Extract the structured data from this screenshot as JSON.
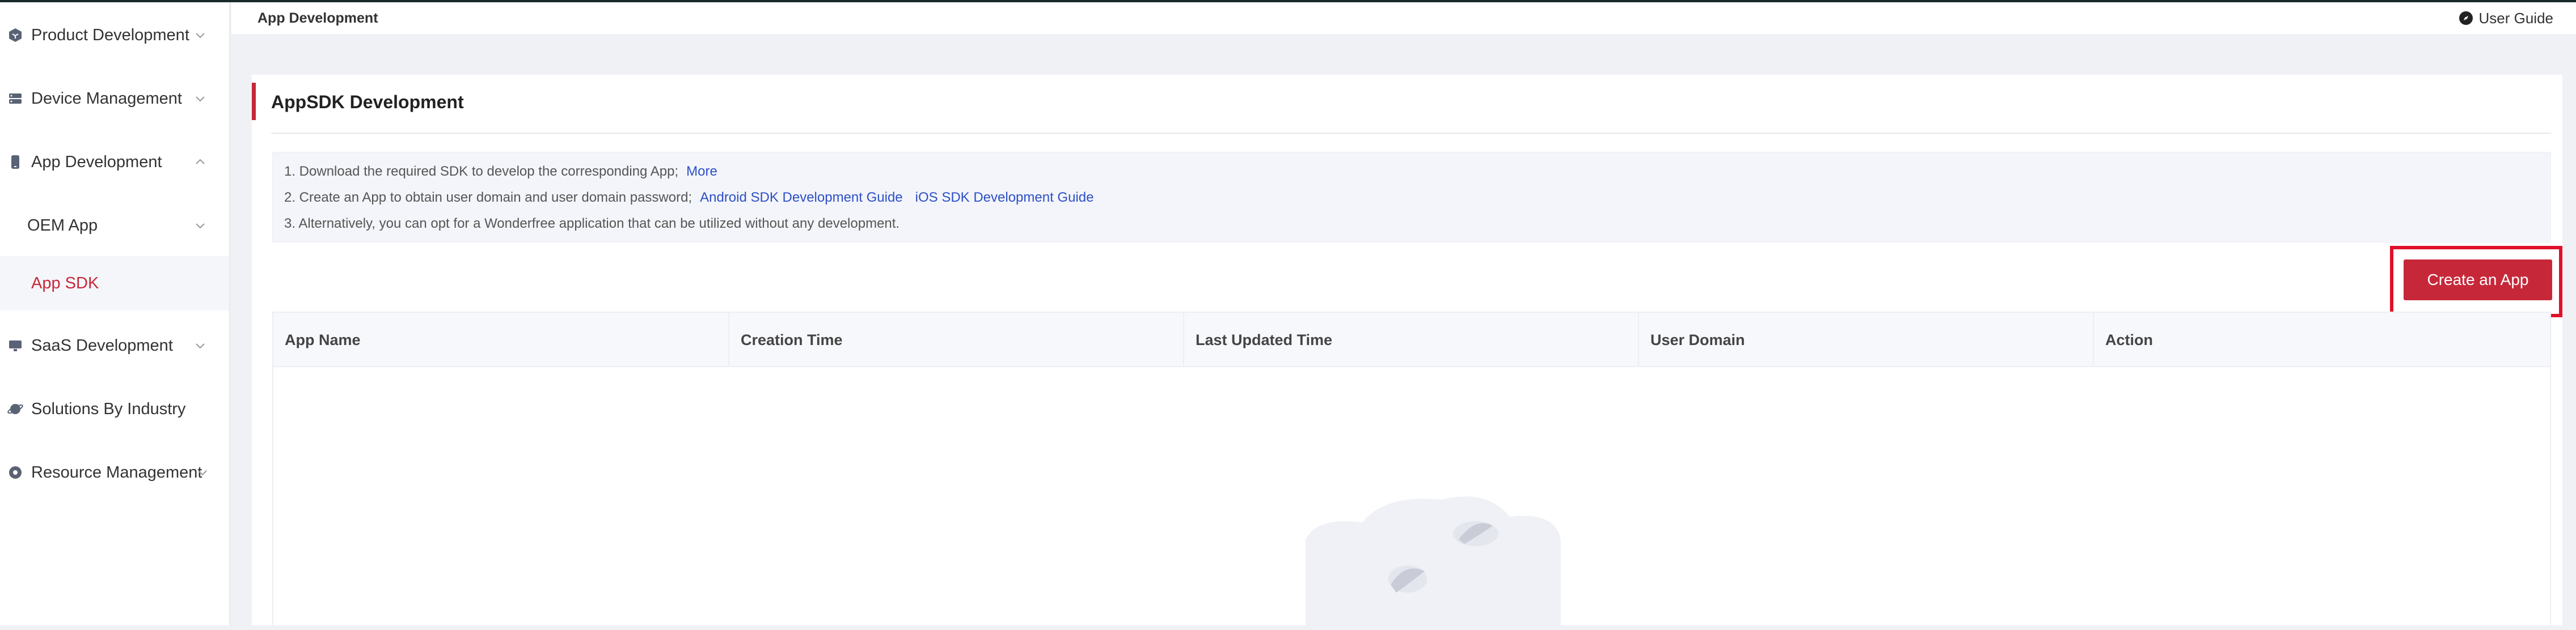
{
  "sidebar": {
    "items": [
      {
        "label": "Product Development",
        "icon": "cube-icon",
        "state": "collapsed"
      },
      {
        "label": "Device Management",
        "icon": "server-icon",
        "state": "collapsed"
      },
      {
        "label": "App Development",
        "icon": "phone-icon",
        "state": "expanded"
      },
      {
        "label": "OEM App",
        "state": "collapsed"
      },
      {
        "label": "App SDK",
        "state": "active"
      },
      {
        "label": "SaaS Development",
        "icon": "monitor-icon",
        "state": "collapsed"
      },
      {
        "label": "Solutions By Industry",
        "icon": "planet-icon"
      },
      {
        "label": "Resource Management",
        "icon": "gear-icon",
        "state": "collapsed"
      }
    ]
  },
  "header": {
    "breadcrumb": "App Development",
    "user_guide": "User Guide"
  },
  "main": {
    "title": "AppSDK Development",
    "notice": {
      "line1_text": "1. Download the required SDK to develop the corresponding App;",
      "line1_link": "More",
      "line2_text": "2. Create an App to obtain user domain and user domain password;",
      "line2_link1": "Android SDK Development Guide",
      "line2_link2": "iOS SDK Development Guide",
      "line3_text": "3. Alternatively, you can opt for a Wonderfree application that can be utilized without any development."
    },
    "create_button": "Create an App",
    "table": {
      "columns": [
        "App Name",
        "Creation Time",
        "Last Updated Time",
        "User Domain",
        "Action"
      ]
    }
  },
  "colors": {
    "accent": "#c6283a",
    "link": "#2e4fc6",
    "highlight": "#e0102a"
  }
}
